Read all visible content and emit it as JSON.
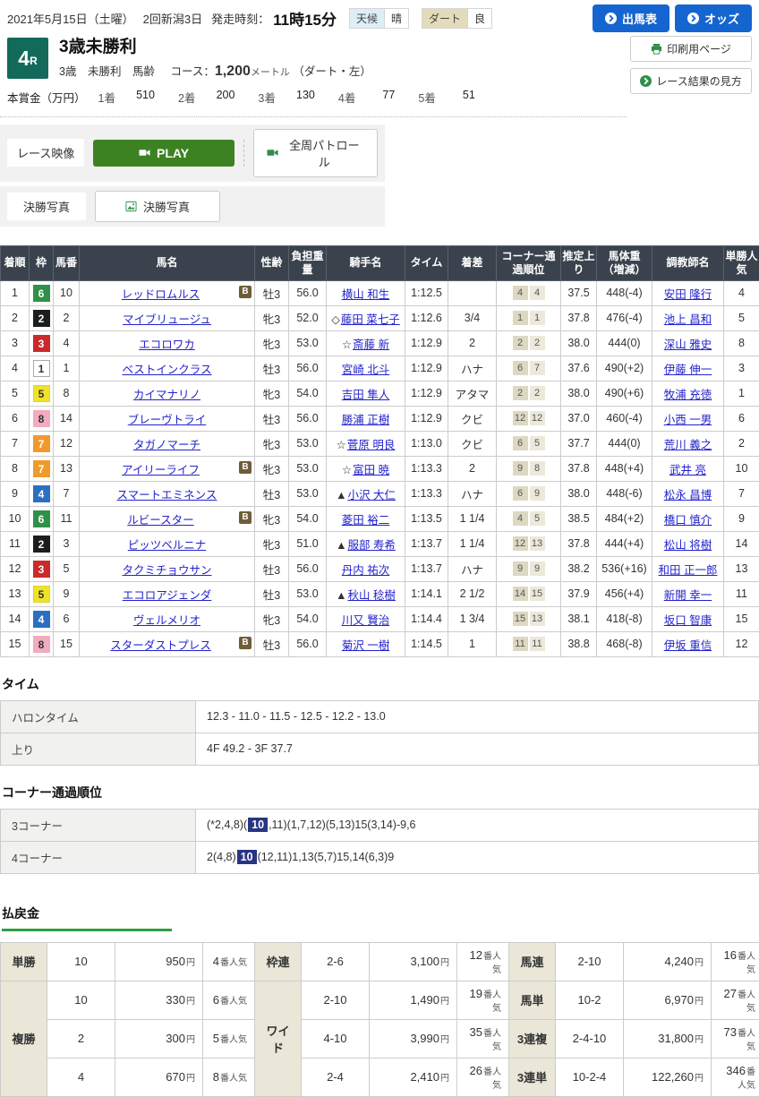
{
  "header": {
    "date": "2021年5月15日（土曜）",
    "meet": "2回新潟3日",
    "start_label": "発走時刻：",
    "start_time": "11時15分",
    "weather_label": "天候",
    "weather_value": "晴",
    "track_label": "ダート",
    "track_value": "良",
    "btn_shutsuba": "出馬表",
    "btn_odds": "オッズ",
    "race_number": "4",
    "race_number_suffix": "R",
    "race_title": "3歳未勝利",
    "race_conditions": "3歳　未勝利　馬齢",
    "course_label": "コース：",
    "course_distance": "1,200",
    "course_unit": "メートル",
    "course_note": "（ダート・左）",
    "btn_print": "印刷用ページ",
    "btn_guide": "レース結果の見方",
    "prize": {
      "label": "本賞金（万円）",
      "items": [
        {
          "place": "1着",
          "amount": "510"
        },
        {
          "place": "2着",
          "amount": "200"
        },
        {
          "place": "3着",
          "amount": "130"
        },
        {
          "place": "4着",
          "amount": "77"
        },
        {
          "place": "5着",
          "amount": "51"
        }
      ]
    }
  },
  "media": {
    "video_label": "レース映像",
    "play_label": "PLAY",
    "patrol_label": "全周パトロール",
    "photo_label": "決勝写真",
    "photo_button": "決勝写真"
  },
  "results": {
    "columns": [
      "着順",
      "枠",
      "馬番",
      "馬名",
      "性齢",
      "負担重量",
      "騎手名",
      "タイム",
      "着差",
      "コーナー通過順位",
      "推定上り",
      "馬体重（増減）",
      "調教師名",
      "単勝人気"
    ],
    "blinker_label": "B",
    "waku_colors": {
      "1": {
        "bg": "#ffffff",
        "fg": "#333333",
        "border": "#aaaaaa"
      },
      "2": {
        "bg": "#1d1d1d",
        "fg": "#ffffff",
        "border": "#1d1d1d"
      },
      "3": {
        "bg": "#c92a2a",
        "fg": "#ffffff",
        "border": "#c92a2a"
      },
      "4": {
        "bg": "#2b6fc2",
        "fg": "#ffffff",
        "border": "#2b6fc2"
      },
      "5": {
        "bg": "#efe32a",
        "fg": "#333333",
        "border": "#e0d424"
      },
      "6": {
        "bg": "#2f9148",
        "fg": "#ffffff",
        "border": "#2f9148"
      },
      "7": {
        "bg": "#f09a2d",
        "fg": "#ffffff",
        "border": "#f09a2d"
      },
      "8": {
        "bg": "#f3abbe",
        "fg": "#333333",
        "border": "#f3abbe"
      }
    },
    "rows": [
      {
        "pos": "1",
        "waku": "6",
        "num": "10",
        "horse": "レッドロムルス",
        "blinker": true,
        "sexage": "牡3",
        "weight": "56.0",
        "jmark": "",
        "jockey": "横山 和生",
        "time": "1:12.5",
        "margin": "",
        "corners": [
          "4",
          "4"
        ],
        "last3f": "37.5",
        "bodyweight": "448(-4)",
        "trainer": "安田 隆行",
        "pop": "4"
      },
      {
        "pos": "2",
        "waku": "2",
        "num": "2",
        "horse": "マイブリュージュ",
        "blinker": false,
        "sexage": "牝3",
        "weight": "52.0",
        "jmark": "◇",
        "jockey": "藤田 菜七子",
        "time": "1:12.6",
        "margin": "3/4",
        "corners": [
          "1",
          "1"
        ],
        "last3f": "37.8",
        "bodyweight": "476(-4)",
        "trainer": "池上 昌和",
        "pop": "5"
      },
      {
        "pos": "3",
        "waku": "3",
        "num": "4",
        "horse": "エコロワカ",
        "blinker": false,
        "sexage": "牝3",
        "weight": "53.0",
        "jmark": "☆",
        "jockey": "斎藤 新",
        "time": "1:12.9",
        "margin": "2",
        "corners": [
          "2",
          "2"
        ],
        "last3f": "38.0",
        "bodyweight": "444(0)",
        "trainer": "深山 雅史",
        "pop": "8"
      },
      {
        "pos": "4",
        "waku": "1",
        "num": "1",
        "horse": "ベストインクラス",
        "blinker": false,
        "sexage": "牡3",
        "weight": "56.0",
        "jmark": "",
        "jockey": "宮崎 北斗",
        "time": "1:12.9",
        "margin": "ハナ",
        "corners": [
          "6",
          "7"
        ],
        "last3f": "37.6",
        "bodyweight": "490(+2)",
        "trainer": "伊藤 伸一",
        "pop": "3"
      },
      {
        "pos": "5",
        "waku": "5",
        "num": "8",
        "horse": "カイマナリノ",
        "blinker": false,
        "sexage": "牝3",
        "weight": "54.0",
        "jmark": "",
        "jockey": "吉田 隼人",
        "time": "1:12.9",
        "margin": "アタマ",
        "corners": [
          "2",
          "2"
        ],
        "last3f": "38.0",
        "bodyweight": "490(+6)",
        "trainer": "牧浦 充徳",
        "pop": "1"
      },
      {
        "pos": "6",
        "waku": "8",
        "num": "14",
        "horse": "ブレーヴトライ",
        "blinker": false,
        "sexage": "牡3",
        "weight": "56.0",
        "jmark": "",
        "jockey": "勝浦 正樹",
        "time": "1:12.9",
        "margin": "クビ",
        "corners": [
          "12",
          "12"
        ],
        "last3f": "37.0",
        "bodyweight": "460(-4)",
        "trainer": "小西 一男",
        "pop": "6"
      },
      {
        "pos": "7",
        "waku": "7",
        "num": "12",
        "horse": "タガノマーチ",
        "blinker": false,
        "sexage": "牝3",
        "weight": "53.0",
        "jmark": "☆",
        "jockey": "菅原 明良",
        "time": "1:13.0",
        "margin": "クビ",
        "corners": [
          "6",
          "5"
        ],
        "last3f": "37.7",
        "bodyweight": "444(0)",
        "trainer": "荒川 義之",
        "pop": "2"
      },
      {
        "pos": "8",
        "waku": "7",
        "num": "13",
        "horse": "アイリーライフ",
        "blinker": true,
        "sexage": "牝3",
        "weight": "53.0",
        "jmark": "☆",
        "jockey": "富田 暁",
        "time": "1:13.3",
        "margin": "2",
        "corners": [
          "9",
          "8"
        ],
        "last3f": "37.8",
        "bodyweight": "448(+4)",
        "trainer": "武井 亮",
        "pop": "10"
      },
      {
        "pos": "9",
        "waku": "4",
        "num": "7",
        "horse": "スマートエミネンス",
        "blinker": false,
        "sexage": "牡3",
        "weight": "53.0",
        "jmark": "▲",
        "jockey": "小沢 大仁",
        "time": "1:13.3",
        "margin": "ハナ",
        "corners": [
          "6",
          "9"
        ],
        "last3f": "38.0",
        "bodyweight": "448(-6)",
        "trainer": "松永 昌博",
        "pop": "7"
      },
      {
        "pos": "10",
        "waku": "6",
        "num": "11",
        "horse": "ルビースター",
        "blinker": true,
        "sexage": "牝3",
        "weight": "54.0",
        "jmark": "",
        "jockey": "菱田 裕二",
        "time": "1:13.5",
        "margin": "1 1/4",
        "corners": [
          "4",
          "5"
        ],
        "last3f": "38.5",
        "bodyweight": "484(+2)",
        "trainer": "橋口 慎介",
        "pop": "9"
      },
      {
        "pos": "11",
        "waku": "2",
        "num": "3",
        "horse": "ピッツベルニナ",
        "blinker": false,
        "sexage": "牝3",
        "weight": "51.0",
        "jmark": "▲",
        "jockey": "服部 寿希",
        "time": "1:13.7",
        "margin": "1 1/4",
        "corners": [
          "12",
          "13"
        ],
        "last3f": "37.8",
        "bodyweight": "444(+4)",
        "trainer": "松山 将樹",
        "pop": "14"
      },
      {
        "pos": "12",
        "waku": "3",
        "num": "5",
        "horse": "タクミチョウサン",
        "blinker": false,
        "sexage": "牡3",
        "weight": "56.0",
        "jmark": "",
        "jockey": "丹内 祐次",
        "time": "1:13.7",
        "margin": "ハナ",
        "corners": [
          "9",
          "9"
        ],
        "last3f": "38.2",
        "bodyweight": "536(+16)",
        "trainer": "和田 正一郎",
        "pop": "13"
      },
      {
        "pos": "13",
        "waku": "5",
        "num": "9",
        "horse": "エコロアジェンダ",
        "blinker": false,
        "sexage": "牡3",
        "weight": "53.0",
        "jmark": "▲",
        "jockey": "秋山 稔樹",
        "time": "1:14.1",
        "margin": "2 1/2",
        "corners": [
          "14",
          "15"
        ],
        "last3f": "37.9",
        "bodyweight": "456(+4)",
        "trainer": "新開 幸一",
        "pop": "11"
      },
      {
        "pos": "14",
        "waku": "4",
        "num": "6",
        "horse": "ヴェルメリオ",
        "blinker": false,
        "sexage": "牝3",
        "weight": "54.0",
        "jmark": "",
        "jockey": "川又 賢治",
        "time": "1:14.4",
        "margin": "1 3/4",
        "corners": [
          "15",
          "13"
        ],
        "last3f": "38.1",
        "bodyweight": "418(-8)",
        "trainer": "坂口 智康",
        "pop": "15"
      },
      {
        "pos": "15",
        "waku": "8",
        "num": "15",
        "horse": "スターダストプレス",
        "blinker": true,
        "sexage": "牡3",
        "weight": "56.0",
        "jmark": "",
        "jockey": "菊沢 一樹",
        "time": "1:14.5",
        "margin": "1",
        "corners": [
          "11",
          "11"
        ],
        "last3f": "38.8",
        "bodyweight": "468(-8)",
        "trainer": "伊坂 重信",
        "pop": "12"
      }
    ]
  },
  "time_section": {
    "title": "タイム",
    "rows": [
      {
        "label": "ハロンタイム",
        "value": "12.3 - 11.0 - 11.5 - 12.5 - 12.2 - 13.0"
      },
      {
        "label": "上り",
        "value": "4F 49.2 - 3F 37.7"
      }
    ]
  },
  "corner_section": {
    "title": "コーナー通過順位",
    "rows": [
      {
        "label": "3コーナー",
        "before": "(*2,4,8)(",
        "highlight": "10",
        "after": ",11)(1,7,12)(5,13)15(3,14)-9,6"
      },
      {
        "label": "4コーナー",
        "before": "2(4,8)",
        "highlight": "10",
        "after": "(12,11)1,13(5,7)15,14(6,3)9"
      }
    ]
  },
  "payouts": {
    "title": "払戻金",
    "yen": "円",
    "pop_suffix": "番人気",
    "groups": [
      {
        "bets": [
          {
            "label": "単勝",
            "rows": [
              {
                "combo": "10",
                "amount": "950",
                "pop": "4"
              }
            ]
          },
          {
            "label": "複勝",
            "rows": [
              {
                "combo": "10",
                "amount": "330",
                "pop": "6"
              },
              {
                "combo": "2",
                "amount": "300",
                "pop": "5"
              },
              {
                "combo": "4",
                "amount": "670",
                "pop": "8"
              }
            ]
          }
        ]
      },
      {
        "bets": [
          {
            "label": "枠連",
            "rows": [
              {
                "combo": "2-6",
                "amount": "3,100",
                "pop": "12"
              }
            ]
          },
          {
            "label": "ワイド",
            "rows": [
              {
                "combo": "2-10",
                "amount": "1,490",
                "pop": "19"
              },
              {
                "combo": "4-10",
                "amount": "3,990",
                "pop": "35"
              },
              {
                "combo": "2-4",
                "amount": "2,410",
                "pop": "26"
              }
            ]
          }
        ]
      },
      {
        "bets": [
          {
            "label": "馬連",
            "rows": [
              {
                "combo": "2-10",
                "amount": "4,240",
                "pop": "16"
              }
            ]
          },
          {
            "label": "馬単",
            "rows": [
              {
                "combo": "10-2",
                "amount": "6,970",
                "pop": "27"
              }
            ]
          },
          {
            "label": "3連複",
            "rows": [
              {
                "combo": "2-4-10",
                "amount": "31,800",
                "pop": "73"
              }
            ]
          },
          {
            "label": "3連単",
            "rows": [
              {
                "combo": "10-2-4",
                "amount": "122,260",
                "pop": "346"
              }
            ]
          }
        ]
      }
    ]
  },
  "colors": {
    "table_header_bg": "#3a434d",
    "race_box_green": "#13695a",
    "play_green": "#3d8222",
    "button_blue": "#1565d0",
    "link_blue": "#2323cc",
    "highlight_navy": "#283583",
    "payout_label_bg": "#eae7d8",
    "payout_tab_green": "#2f9e44"
  }
}
